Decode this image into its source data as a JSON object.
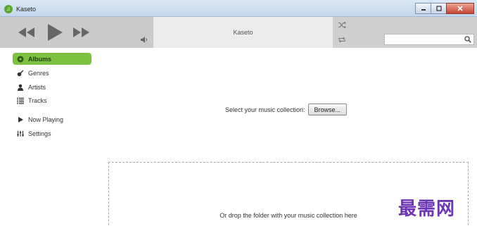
{
  "window": {
    "title": "Kaseto",
    "app_icon_glyph": "♫",
    "controls": [
      "minimize",
      "maximize",
      "close"
    ]
  },
  "player": {
    "now_playing_title": "Kaseto",
    "icons": [
      "previous-icon",
      "play-icon",
      "next-icon",
      "volume-icon",
      "shuffle-icon",
      "repeat-icon"
    ],
    "search": {
      "value": "",
      "placeholder": ""
    }
  },
  "sidebar": {
    "accent_color": "#7ec040",
    "items": [
      {
        "label": "Albums",
        "icon": "album-icon",
        "active": true
      },
      {
        "label": "Genres",
        "icon": "guitar-icon",
        "active": false
      },
      {
        "label": "Artists",
        "icon": "person-icon",
        "active": false
      },
      {
        "label": "Tracks",
        "icon": "list-icon",
        "active": false
      },
      {
        "label": "Now Playing",
        "icon": "play-icon",
        "active": false
      },
      {
        "label": "Settings",
        "icon": "sliders-icon",
        "active": false
      }
    ]
  },
  "main": {
    "select_label": "Select your music collection:",
    "browse_label": "Browse...",
    "drop_text": "Or drop the folder with your music collection here"
  },
  "watermark": "最需网"
}
